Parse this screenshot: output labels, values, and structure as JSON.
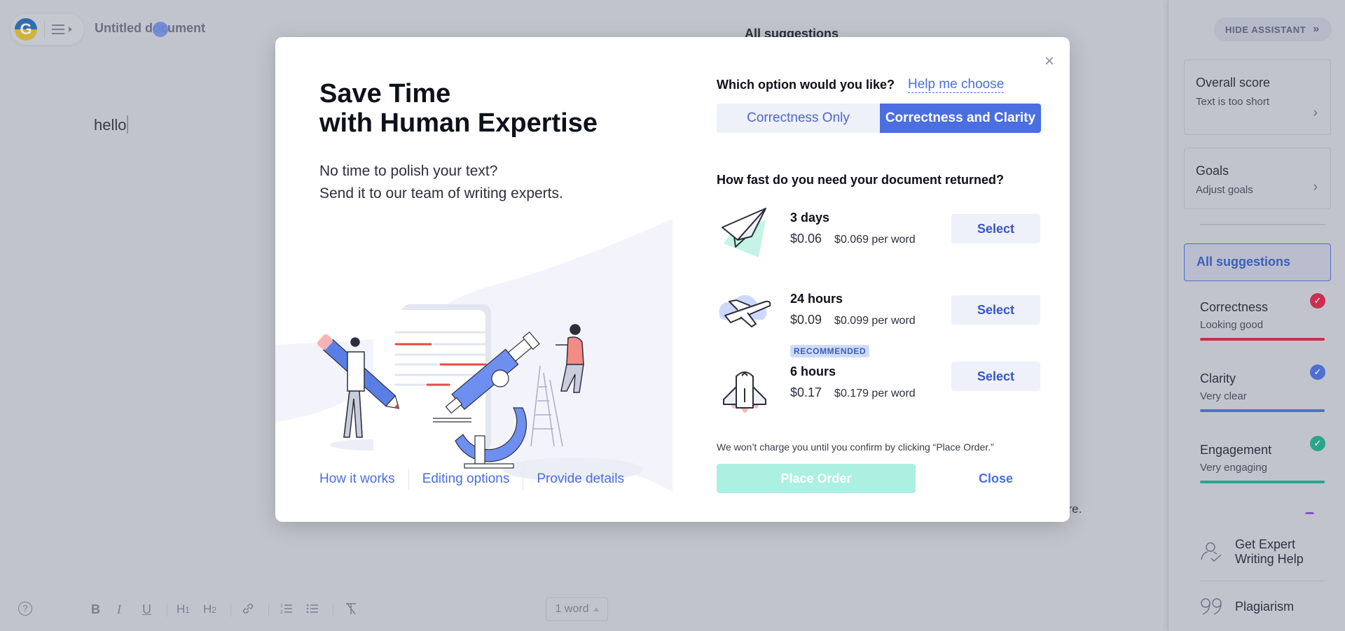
{
  "editor": {
    "logo_letter": "G",
    "document_title": "Untitled document",
    "body_text": "hello",
    "background_heading": "All suggestions",
    "background_tail_text": "ore.",
    "toolbar": {
      "help": "?",
      "bold": "B",
      "italic": "I",
      "underline": "U",
      "h1": "H1",
      "h2": "H2",
      "link": "link",
      "ordered_list": "ordered-list",
      "bulleted_list": "bulleted-list",
      "clear_format": "clear-formatting"
    },
    "word_count": "1 word"
  },
  "assistant": {
    "hide_button": "HIDE ASSISTANT",
    "hide_chevron": "»",
    "overall": {
      "title": "Overall score",
      "subtitle": "Text is too short"
    },
    "goals": {
      "title": "Goals",
      "subtitle": "Adjust goals"
    },
    "all_suggestions": "All suggestions",
    "categories": [
      {
        "name": "Correctness",
        "status": "Looking good",
        "color": "#c9304f"
      },
      {
        "name": "Clarity",
        "status": "Very clear",
        "color": "#4f6fd1"
      },
      {
        "name": "Engagement",
        "status": "Very engaging",
        "color": "#2ba58a"
      }
    ],
    "expert_help": "Get Expert Writing Help",
    "plagiarism": "Plagiarism"
  },
  "modal": {
    "title_line1": "Save Time",
    "title_line2": "with Human Expertise",
    "subtitle_line1": "No time to polish your text?",
    "subtitle_line2": "Send it to our team of writing experts.",
    "links": [
      "How it works",
      "Editing options",
      "Provide details"
    ],
    "close_icon": "×",
    "option_question": "Which option would you like?",
    "help_link": "Help me choose",
    "options": [
      {
        "label": "Correctness Only",
        "selected": false
      },
      {
        "label": "Correctness and Clarity",
        "selected": true
      }
    ],
    "speed_question": "How fast do you need your document returned?",
    "speeds": [
      {
        "duration": "3 days",
        "price": "$0.06",
        "per_word": "$0.069 per word",
        "select": "Select",
        "badge": ""
      },
      {
        "duration": "24 hours",
        "price": "$0.09",
        "per_word": "$0.099 per word",
        "select": "Select",
        "badge": ""
      },
      {
        "duration": "6 hours",
        "price": "$0.17",
        "per_word": "$0.179 per word",
        "select": "Select",
        "badge": "RECOMMENDED"
      }
    ],
    "disclaimer": "We won’t charge you until you confirm by clicking “Place Order.”",
    "place_order": "Place Order",
    "close": "Close"
  }
}
